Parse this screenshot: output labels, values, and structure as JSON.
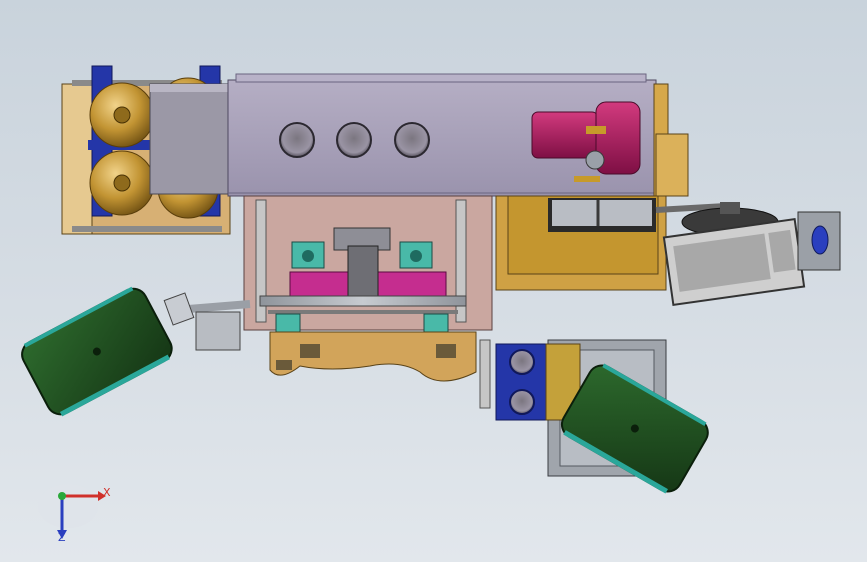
{
  "triad": {
    "x_label": "X",
    "z_label": "Z",
    "x_color": "#d0302a",
    "y_color": "#2aa83a",
    "z_color": "#2a3fbf"
  },
  "palette": {
    "frame": "#a9a2b8",
    "wood": "#d2a45a",
    "gold": "#c8952e",
    "tank_gold": "#b58a2a",
    "blue_bracket": "#2436a8",
    "pink_plate": "#caa7a0",
    "magenta": "#b01e62",
    "dark_green": "#1f4a1f",
    "teal_rim": "#2aa79a",
    "keyboard": "#d6d6d6",
    "grey_steel": "#9aa0a8"
  }
}
